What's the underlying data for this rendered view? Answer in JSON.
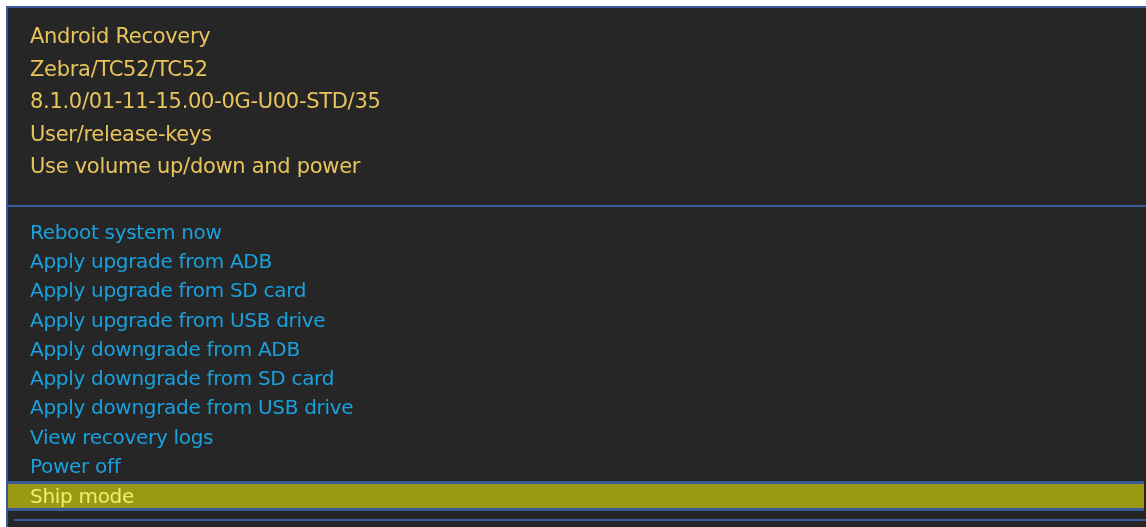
{
  "header_lines": [
    "Android Recovery",
    "Zebra/TC52/TC52",
    "8.1.0/01-11-15.00-0G-U00-STD/35",
    "User/release-keys",
    "Use volume up/down and power"
  ],
  "menu": [
    {
      "label": "Reboot system now",
      "selected": false
    },
    {
      "label": "Apply upgrade from ADB",
      "selected": false
    },
    {
      "label": "Apply upgrade from SD card",
      "selected": false
    },
    {
      "label": "Apply upgrade from USB drive",
      "selected": false
    },
    {
      "label": "Apply downgrade from ADB",
      "selected": false
    },
    {
      "label": "Apply downgrade from SD card",
      "selected": false
    },
    {
      "label": "Apply downgrade from USB drive",
      "selected": false
    },
    {
      "label": "View recovery logs",
      "selected": false
    },
    {
      "label": "Power off",
      "selected": false
    },
    {
      "label": "Ship mode",
      "selected": true
    }
  ]
}
